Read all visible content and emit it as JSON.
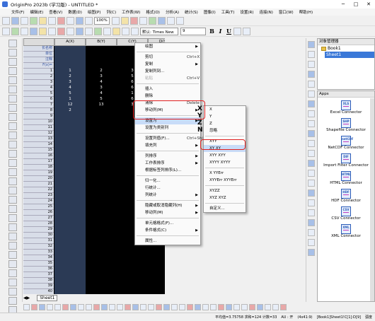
{
  "window": {
    "title": "OriginPro 2023b (学习版) - UNTITLED *",
    "controls": [
      "─",
      "□",
      "✕"
    ]
  },
  "menubar": [
    "文件(F)",
    "编辑(E)",
    "查看(V)",
    "数据(D)",
    "绘图(P)",
    "列(C)",
    "工作表(W)",
    "格式(O)",
    "分析(A)",
    "统计(S)",
    "图像(I)",
    "工具(T)",
    "设置(R)",
    "连接(N)",
    "窗口(W)",
    "帮助(H)"
  ],
  "toolbar": {
    "zoom": "100%",
    "font": "默认: Times New",
    "font_size": "9",
    "bold": "B",
    "italic": "I",
    "underline": "U"
  },
  "worksheet": {
    "columns": [
      "A(X)",
      "B(Y)",
      "C(Y)",
      "D(Y)"
    ],
    "row_labels": [
      "长名称",
      "单位",
      "注释",
      "F(x)="
    ],
    "rows": [
      [
        "1",
        "2",
        "3"
      ],
      [
        "2",
        "3",
        "5"
      ],
      [
        "3",
        "4",
        "6"
      ],
      [
        "4",
        "3",
        "6"
      ],
      [
        "5",
        "4",
        "1"
      ],
      [
        "1",
        "5",
        "6"
      ],
      [
        "12",
        "13",
        "3"
      ],
      [
        "2",
        "",
        ""
      ]
    ],
    "row_count": 43
  },
  "context_menu": {
    "items": [
      {
        "label": "绘图",
        "shortcut": "",
        "sub": true
      },
      {
        "sep": true
      },
      {
        "label": "剪切",
        "shortcut": "Ctrl+X"
      },
      {
        "label": "复制",
        "shortcut": "",
        "sub": true
      },
      {
        "label": "复制列到...",
        "shortcut": ""
      },
      {
        "label": "粘贴",
        "shortcut": "Ctrl+V",
        "disabled": true
      },
      {
        "sep": true
      },
      {
        "label": "插入",
        "shortcut": ""
      },
      {
        "label": "删除",
        "shortcut": ""
      },
      {
        "label": "清除",
        "shortcut": "Delete"
      },
      {
        "label": "移动列(M)",
        "shortcut": "",
        "sub": true
      },
      {
        "sep": true
      },
      {
        "label": "设置为",
        "shortcut": "",
        "sub": true,
        "highlight": true
      },
      {
        "label": "设置为类别列",
        "shortcut": ""
      },
      {
        "sep": true
      },
      {
        "label": "设置列值(F)...",
        "shortcut": "Ctrl+Shift+Q"
      },
      {
        "label": "填充列",
        "shortcut": "",
        "sub": true
      },
      {
        "sep": true
      },
      {
        "label": "列排序",
        "shortcut": "",
        "sub": true
      },
      {
        "label": "工作表排序",
        "shortcut": "",
        "sub": true
      },
      {
        "label": "根据标签列排序(L)...",
        "shortcut": ""
      },
      {
        "sep": true
      },
      {
        "label": "归一化...",
        "shortcut": ""
      },
      {
        "label": "行统计...",
        "shortcut": ""
      },
      {
        "label": "列统计",
        "shortcut": "",
        "sub": true
      },
      {
        "sep": true
      },
      {
        "label": "隐藏或取消隐藏列(H)",
        "shortcut": "",
        "sub": true
      },
      {
        "label": "移动列(M)",
        "shortcut": "",
        "sub": true
      },
      {
        "sep": true
      },
      {
        "label": "单元格格式(F)...",
        "shortcut": ""
      },
      {
        "label": "条件格式(C)",
        "shortcut": "",
        "sub": true
      },
      {
        "sep": true
      },
      {
        "label": "属性...",
        "shortcut": ""
      }
    ]
  },
  "submenu": {
    "items": [
      {
        "label": "X",
        "glyph": "X"
      },
      {
        "label": "Y",
        "glyph": "Y"
      },
      {
        "label": "Z",
        "glyph": "Z"
      },
      {
        "label": "忽略",
        "glyph": "N"
      },
      {
        "sep": true
      },
      {
        "label": "XYY"
      },
      {
        "label": "XY XY",
        "highlight": true
      },
      {
        "label": "XYY XYY"
      },
      {
        "label": "XYYY XYYY"
      },
      {
        "sep": true
      },
      {
        "label": "X YYErr"
      },
      {
        "label": "XYYErr XYYErr"
      },
      {
        "sep": true
      },
      {
        "label": "XYZZ"
      },
      {
        "label": "XYZ XYZ"
      },
      {
        "sep": true
      },
      {
        "label": "自定义..."
      }
    ]
  },
  "project_explorer": {
    "title": "对象管理器",
    "book": "Book1",
    "sheet": "Sheet1"
  },
  "apps": {
    "title": "Apps",
    "items": [
      {
        "icon": "XLS",
        "name": "Excel Connector"
      },
      {
        "icon": "SHP",
        "name": "Shapefile Connector"
      },
      {
        "icon": "netCDF",
        "name": "NetCDF Connector"
      },
      {
        "icon": "DIF",
        "name": "Import Filter Connector"
      },
      {
        "icon": "HTML",
        "name": "HTML Connector"
      },
      {
        "icon": "HDF",
        "name": "HDF Connector"
      },
      {
        "icon": "CSV",
        "name": "CSV Connector"
      },
      {
        "icon": "XML",
        "name": "XML Connector"
      }
    ]
  },
  "sheet_tab": "Sheet1",
  "statusbar": [
    "平均值=3.75758 求和=124 计数=33",
    "AU : 开",
    "(4x41:9)",
    "[Book1]Sheet1!C[1]:D[9]",
    "弧度"
  ]
}
